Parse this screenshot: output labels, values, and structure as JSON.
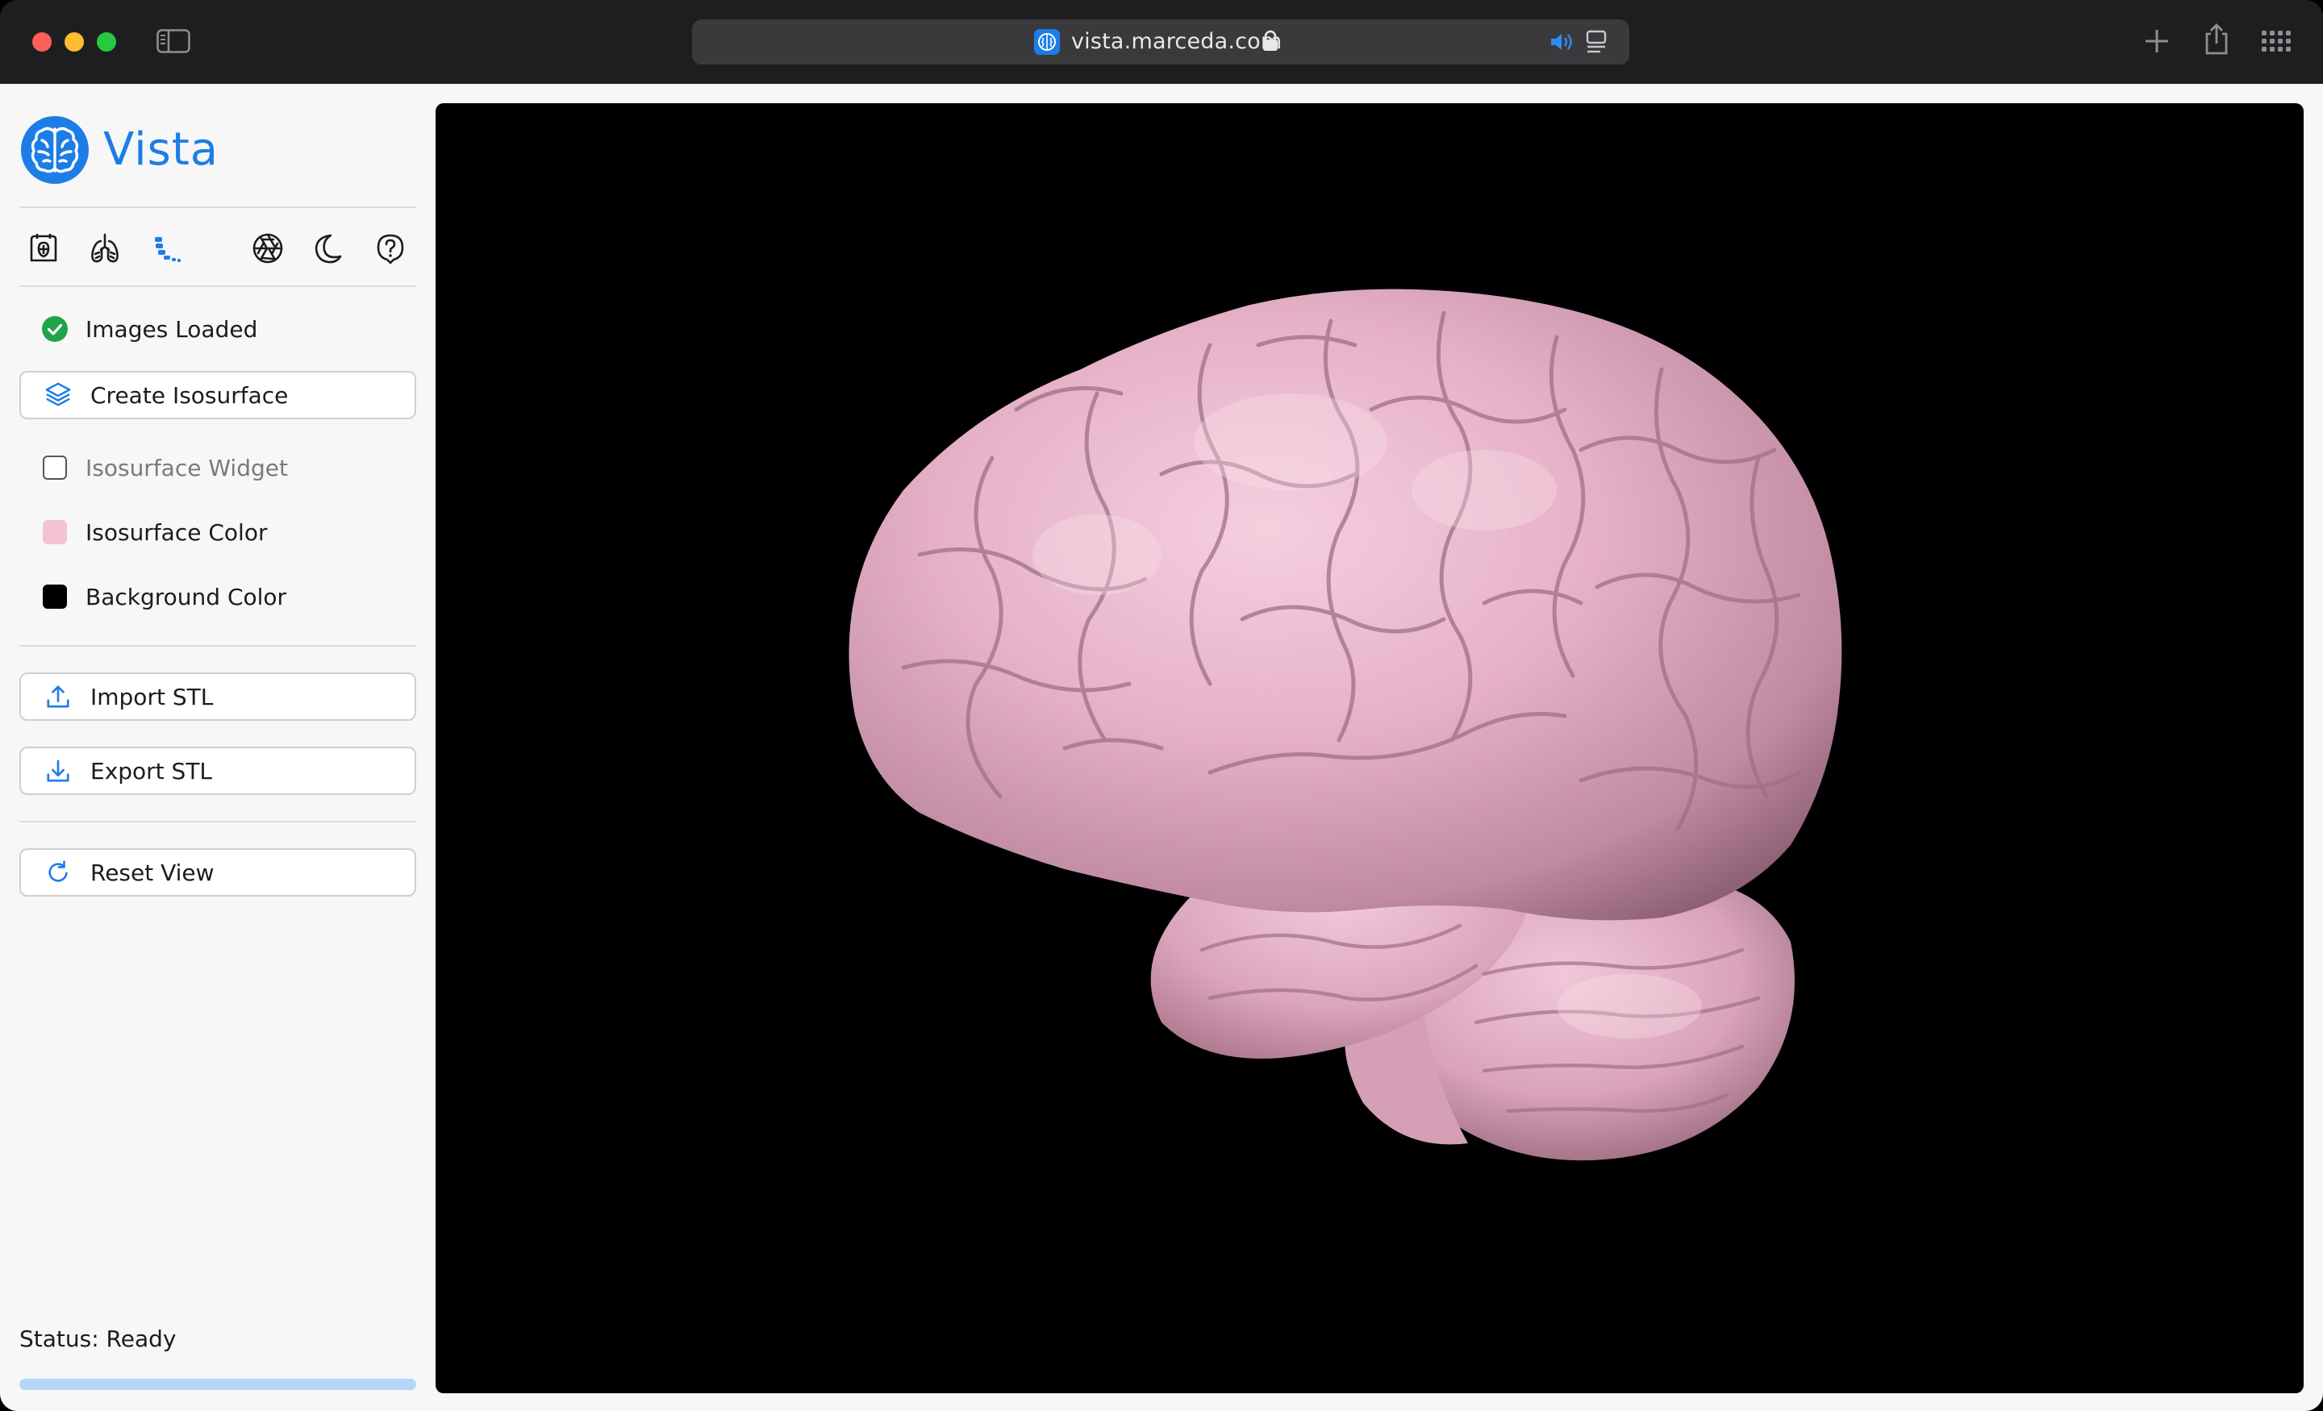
{
  "browser": {
    "url": "vista.marceda.com",
    "icons": {
      "sidebar_toggle": "sidebar-toggle-icon",
      "favicon": "brain-icon",
      "lock": "lock-icon",
      "audio": "speaker-icon",
      "reader": "reader-icon",
      "new_tab": "plus-icon",
      "share": "share-icon",
      "tab_overview": "grid-icon"
    }
  },
  "app": {
    "name": "Vista",
    "accent_color": "#1d7de6",
    "toolbar": [
      {
        "name": "scan-icon",
        "active": false
      },
      {
        "name": "lungs-icon",
        "active": false
      },
      {
        "name": "spine-icon",
        "active": true
      },
      {
        "name": "aperture-icon",
        "active": false
      },
      {
        "name": "moon-icon",
        "active": false
      },
      {
        "name": "help-icon",
        "active": false
      }
    ],
    "status_images_loaded": "Images Loaded",
    "status_icon_color": "#22a34a",
    "create_isosurface_label": "Create Isosurface",
    "isosurface_widget_label": "Isosurface Widget",
    "isosurface_widget_checked": false,
    "isosurface_color_label": "Isosurface Color",
    "isosurface_color": "#f3c3d4",
    "background_color_label": "Background Color",
    "background_color": "#000000",
    "import_stl_label": "Import STL",
    "export_stl_label": "Export STL",
    "reset_view_label": "Reset View",
    "status_text": "Status: Ready",
    "progress": 1.0
  },
  "viewport": {
    "background": "#000000",
    "model": "brain isosurface",
    "surface_color": "#e7b3c8"
  }
}
